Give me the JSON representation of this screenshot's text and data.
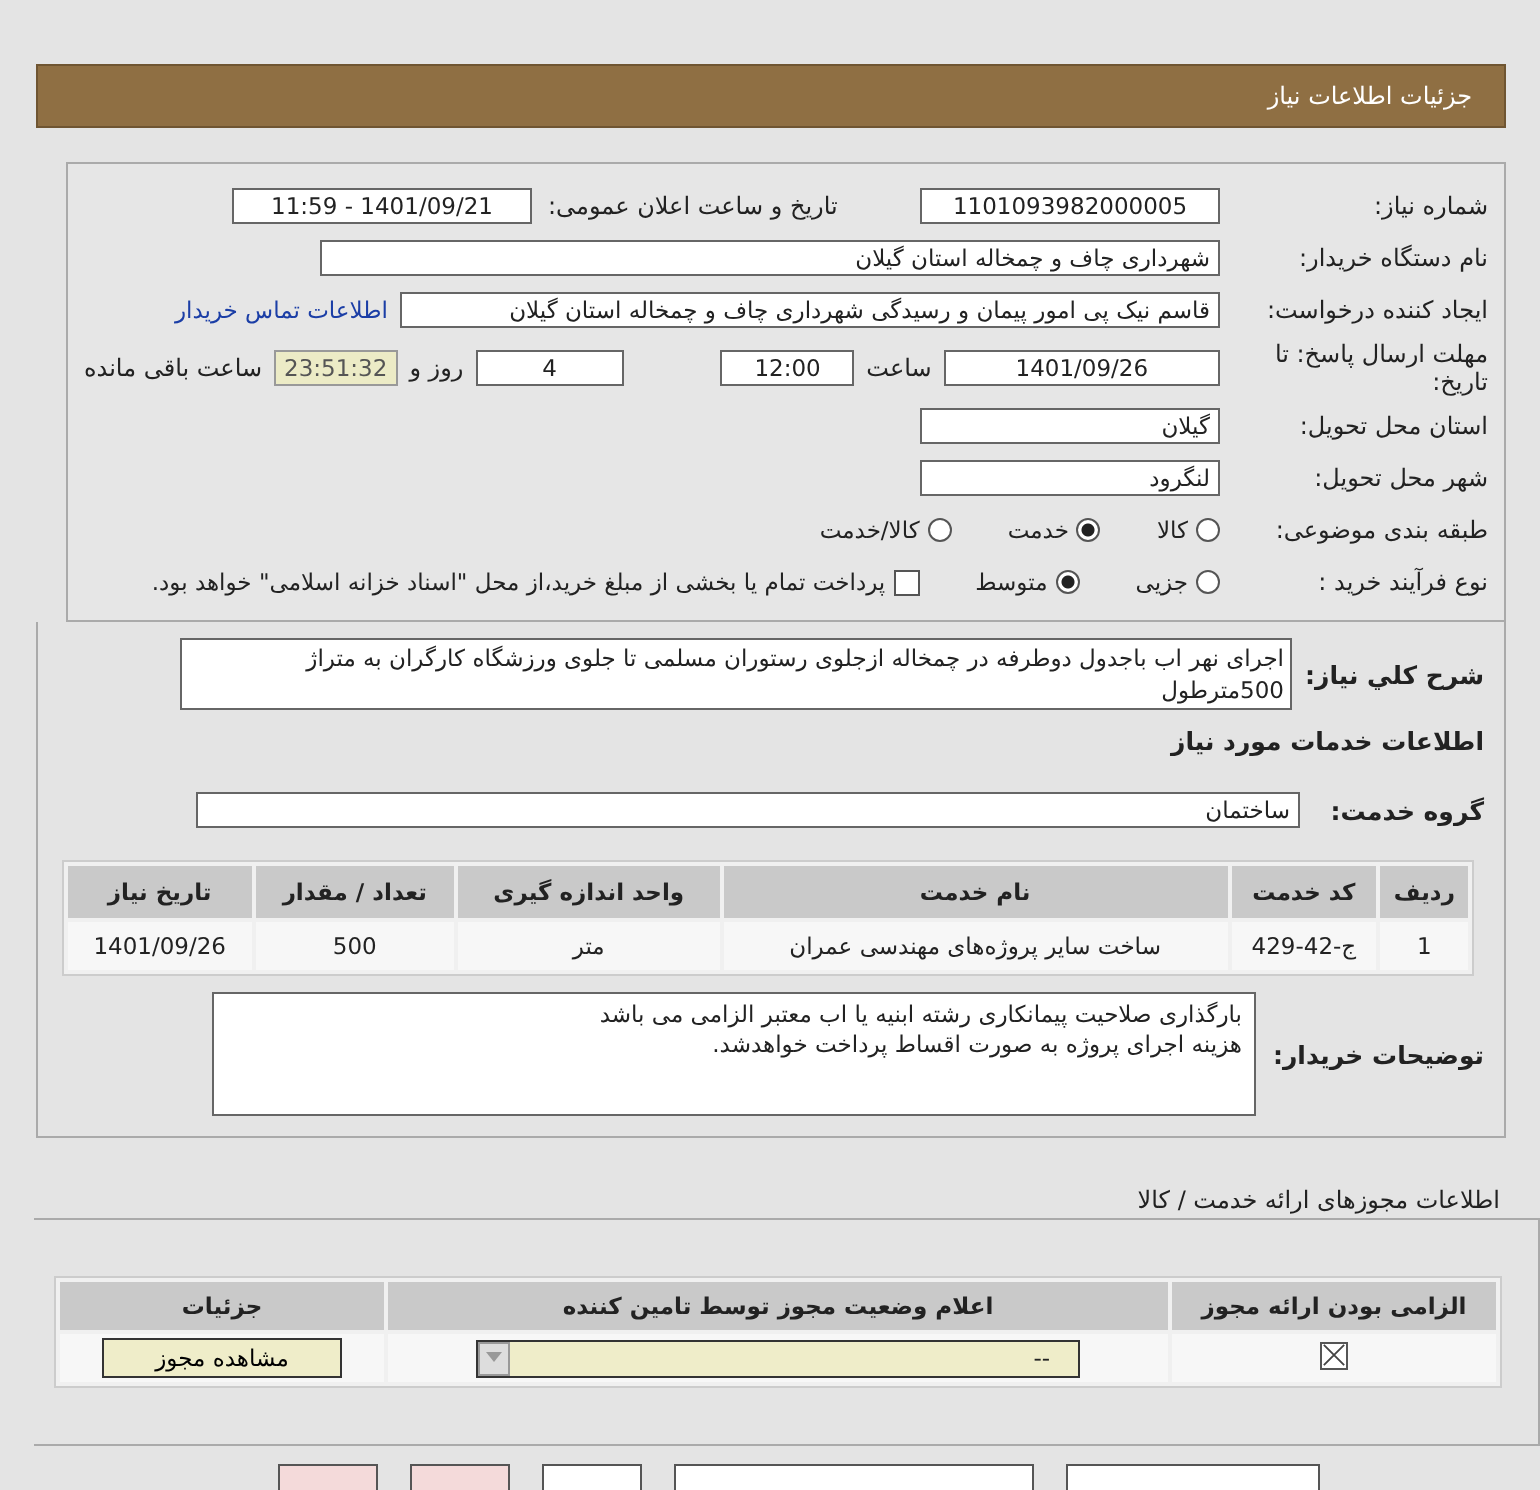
{
  "header": {
    "title": "جزئیات اطلاعات نیاز"
  },
  "need_number": {
    "label": "شماره نیاز:",
    "value": "1101093982000005"
  },
  "announce_date": {
    "label": "تاریخ و ساعت اعلان عمومی:",
    "value": "1401/09/21 - 11:59"
  },
  "buyer_org": {
    "label": "نام دستگاه خریدار:",
    "value": "شهرداری چاف و چمخاله استان گیلان"
  },
  "requester": {
    "label": "ایجاد کننده درخواست:",
    "value": "قاسم نیک پی امور پیمان و رسیدگی شهرداری چاف و چمخاله استان گیلان",
    "link": "اطلاعات تماس خریدار"
  },
  "deadline": {
    "label": "مهلت ارسال پاسخ: تا تاریخ:",
    "date": "1401/09/26",
    "time_label": "ساعت",
    "time": "12:00",
    "days": "4",
    "days_label": "روز و",
    "remaining": "23:51:32",
    "remaining_label": "ساعت باقی مانده"
  },
  "province": {
    "label": "استان محل تحویل:",
    "value": "گیلان"
  },
  "city": {
    "label": "شهر محل تحویل:",
    "value": "لنگرود"
  },
  "category": {
    "label": "طبقه بندی موضوعی:",
    "options": [
      {
        "label": "کالا",
        "selected": false
      },
      {
        "label": "خدمت",
        "selected": true
      },
      {
        "label": "کالا/خدمت",
        "selected": false
      }
    ]
  },
  "purchase_type": {
    "label": "نوع فرآیند خرید :",
    "options": [
      {
        "label": "جزیی",
        "selected": false
      },
      {
        "label": "متوسط",
        "selected": true
      }
    ],
    "checkbox": {
      "label": "پرداخت تمام یا بخشی از مبلغ خرید،از محل \"اسناد خزانه اسلامی\" خواهد بود.",
      "checked": false
    }
  },
  "description": {
    "label": "شرح کلي نیاز:",
    "value": "اجرای نهر اب باجدول دوطرفه در چمخاله ازجلوی رستوران مسلمی تا جلوی ورزشگاه کارگران به متراژ 500مترطول"
  },
  "services_title": "اطلاعات خدمات مورد نیاز",
  "service_group": {
    "label": "گروه خدمت:",
    "value": "ساختمان"
  },
  "table": {
    "columns": [
      "ردیف",
      "کد خدمت",
      "نام خدمت",
      "واحد اندازه گیری",
      "تعداد / مقدار",
      "تاریخ نیاز"
    ],
    "rows": [
      [
        "1",
        "ج-42-429",
        "ساخت سایر پروژه‌های مهندسی عمران",
        "متر",
        "500",
        "1401/09/26"
      ]
    ]
  },
  "buyer_notes": {
    "label": "توضیحات خریدار:",
    "lines": [
      "بارگذاری صلاحیت پیمانکاری رشته ابنیه یا اب معتبر الزامی می باشد",
      "هزینه اجرای پروژه به صورت اقساط پرداخت خواهدشد."
    ]
  },
  "permits_title": "اطلاعات مجوزهای ارائه خدمت / کالا",
  "permits": {
    "columns": [
      "الزامی بودن ارائه مجوز",
      "اعلام وضعیت مجوز توسط تامین کننده",
      "جزئیات"
    ],
    "rows": [
      {
        "required": true,
        "status": "--",
        "button": "مشاهده مجوز"
      }
    ]
  }
}
